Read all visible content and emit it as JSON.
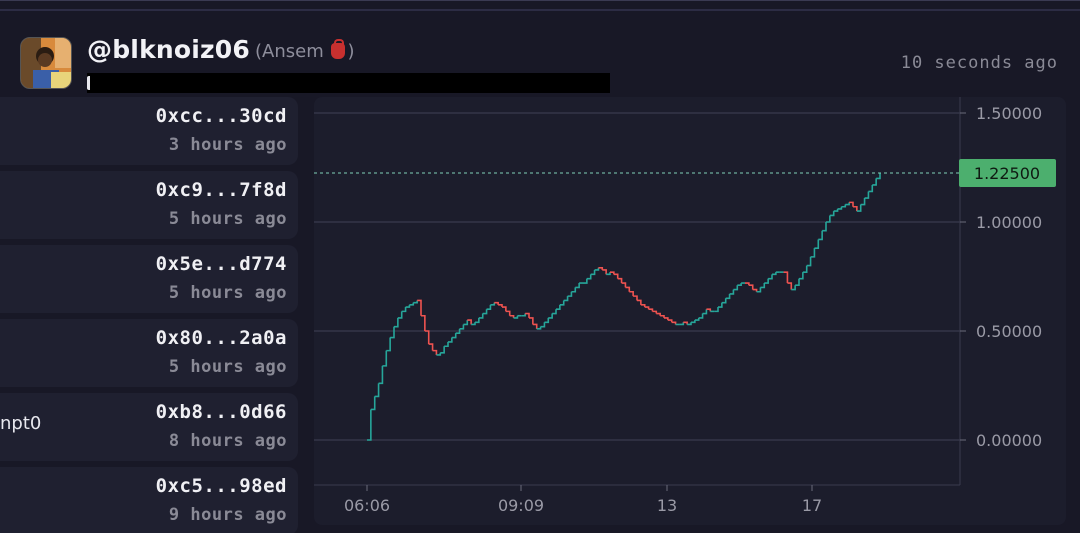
{
  "header": {
    "handle": "@blknoiz06",
    "alias_prefix": "(Ansem",
    "alias_suffix": ")",
    "alias_icon": "red-bag-emoji",
    "timestamp": "10 seconds ago"
  },
  "transactions": [
    {
      "address": "0xcc...30cd",
      "time": "3 hours ago",
      "label": ""
    },
    {
      "address": "0xc9...7f8d",
      "time": "5 hours ago",
      "label": ""
    },
    {
      "address": "0x5e...d774",
      "time": "5 hours ago",
      "label": ""
    },
    {
      "address": "0x80...2a0a",
      "time": "5 hours ago",
      "label": ""
    },
    {
      "address": "0xb8...0d66",
      "time": "8 hours ago",
      "label": "npt0"
    },
    {
      "address": "0xc5...98ed",
      "time": "9 hours ago",
      "label": ""
    }
  ],
  "colors": {
    "up": "#26a69a",
    "down": "#ef5350",
    "price_tag": "#4caf6e",
    "grid": "#3a3b4e"
  },
  "chart_data": {
    "type": "line",
    "x_ticks": [
      "06:06",
      "09:09",
      "13",
      "17"
    ],
    "y_ticks": [
      "1.50000",
      "1.00000",
      "0.50000",
      "0.00000"
    ],
    "ylim": [
      0,
      1.5
    ],
    "current_price": "1.22500",
    "current_value": 1.225,
    "values": [
      0.0,
      0.14,
      0.2,
      0.26,
      0.34,
      0.41,
      0.47,
      0.52,
      0.56,
      0.59,
      0.61,
      0.62,
      0.63,
      0.64,
      0.57,
      0.5,
      0.44,
      0.41,
      0.39,
      0.4,
      0.43,
      0.45,
      0.47,
      0.49,
      0.51,
      0.53,
      0.55,
      0.53,
      0.54,
      0.56,
      0.58,
      0.6,
      0.62,
      0.63,
      0.62,
      0.61,
      0.59,
      0.57,
      0.56,
      0.57,
      0.57,
      0.58,
      0.56,
      0.53,
      0.51,
      0.52,
      0.54,
      0.56,
      0.58,
      0.6,
      0.62,
      0.64,
      0.66,
      0.68,
      0.7,
      0.72,
      0.72,
      0.74,
      0.76,
      0.78,
      0.79,
      0.78,
      0.76,
      0.77,
      0.76,
      0.74,
      0.72,
      0.7,
      0.68,
      0.66,
      0.64,
      0.62,
      0.61,
      0.6,
      0.59,
      0.58,
      0.57,
      0.56,
      0.55,
      0.54,
      0.53,
      0.53,
      0.54,
      0.53,
      0.54,
      0.55,
      0.56,
      0.58,
      0.6,
      0.59,
      0.59,
      0.61,
      0.63,
      0.65,
      0.67,
      0.69,
      0.71,
      0.72,
      0.72,
      0.71,
      0.69,
      0.68,
      0.7,
      0.72,
      0.74,
      0.76,
      0.77,
      0.77,
      0.77,
      0.72,
      0.69,
      0.71,
      0.74,
      0.77,
      0.8,
      0.84,
      0.88,
      0.92,
      0.96,
      1.0,
      1.03,
      1.05,
      1.06,
      1.07,
      1.08,
      1.09,
      1.07,
      1.05,
      1.08,
      1.11,
      1.14,
      1.17,
      1.2,
      1.225
    ]
  }
}
